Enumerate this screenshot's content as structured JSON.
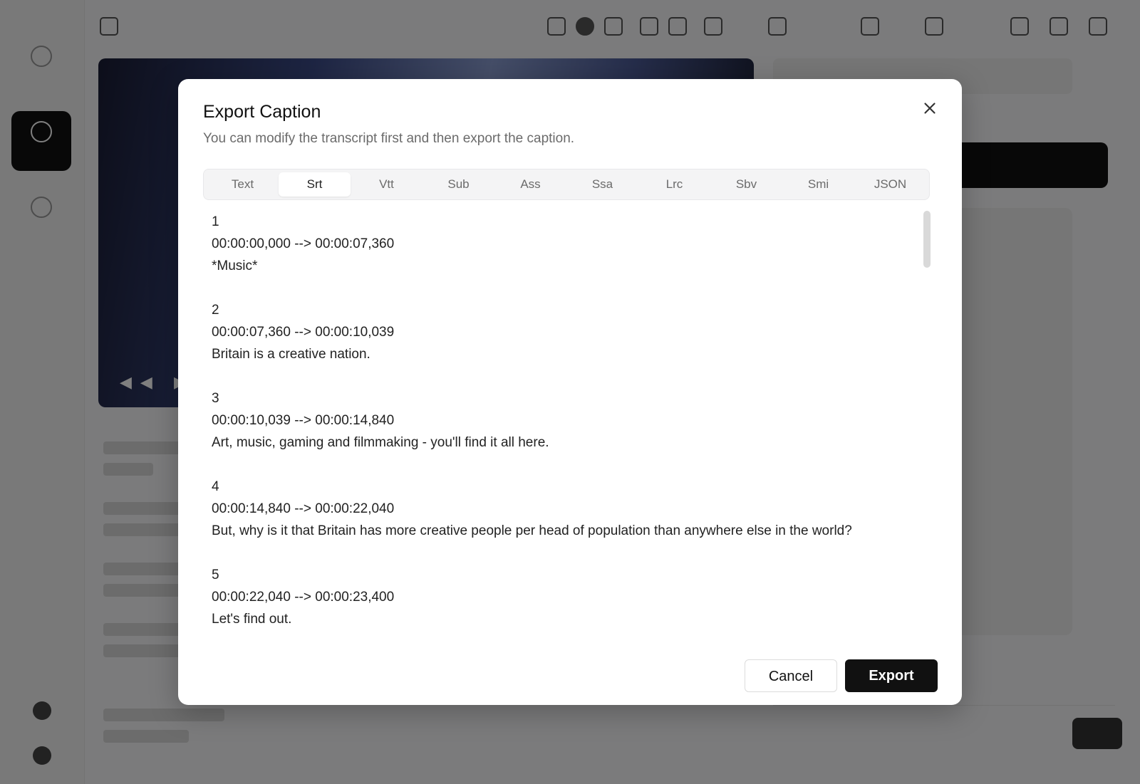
{
  "dialog": {
    "title": "Export Caption",
    "subtitle": "You can modify the transcript first and then export the caption.",
    "tabs": [
      {
        "label": "Text",
        "active": false
      },
      {
        "label": "Srt",
        "active": true
      },
      {
        "label": "Vtt",
        "active": false
      },
      {
        "label": "Sub",
        "active": false
      },
      {
        "label": "Ass",
        "active": false
      },
      {
        "label": "Ssa",
        "active": false
      },
      {
        "label": "Lrc",
        "active": false
      },
      {
        "label": "Sbv",
        "active": false
      },
      {
        "label": "Smi",
        "active": false
      },
      {
        "label": "JSON",
        "active": false
      }
    ],
    "cues": [
      {
        "index": "1",
        "time": "00:00:00,000 --> 00:00:07,360",
        "text": "*Music*"
      },
      {
        "index": "2",
        "time": "00:00:07,360 --> 00:00:10,039",
        "text": "Britain is a creative nation."
      },
      {
        "index": "3",
        "time": "00:00:10,039 --> 00:00:14,840",
        "text": "Art, music, gaming and filmmaking - you'll find it all here."
      },
      {
        "index": "4",
        "time": "00:00:14,840 --> 00:00:22,040",
        "text": "But, why is it that Britain has more creative people per head of population than anywhere else in the world?"
      },
      {
        "index": "5",
        "time": "00:00:22,040 --> 00:00:23,400",
        "text": "Let's find out."
      }
    ],
    "cancel_label": "Cancel",
    "export_label": "Export"
  },
  "colors": {
    "overlay": "#00000080",
    "primary_button": "#111111",
    "active_tab_bg": "#ffffff",
    "tab_bar_bg": "#f4f4f5"
  }
}
